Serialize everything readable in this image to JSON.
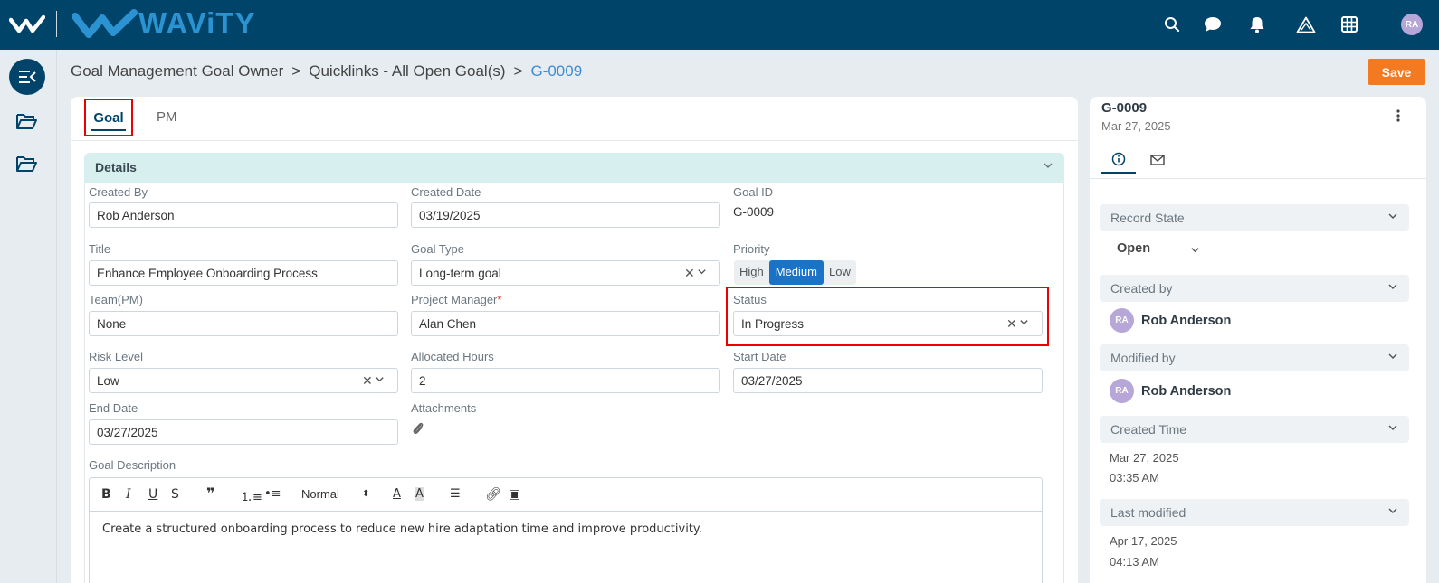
{
  "app": {
    "brand": "WAViTY",
    "avatar_initials": "RA",
    "colors": {
      "topbar": "#00446a",
      "accent": "#2b93d1",
      "save": "#f47a22",
      "highlight": "#e00000"
    }
  },
  "breadcrumb": {
    "items": [
      "Goal Management Goal Owner",
      "Quicklinks - All Open Goal(s)",
      "G-0009"
    ],
    "separator": ">"
  },
  "toolbar": {
    "save_label": "Save"
  },
  "tabs": [
    {
      "label": "Goal",
      "active": true
    },
    {
      "label": "PM",
      "active": false
    }
  ],
  "details": {
    "header": "Details",
    "created_by": {
      "label": "Created By",
      "value": "Rob Anderson"
    },
    "created_date": {
      "label": "Created Date",
      "value": "03/19/2025"
    },
    "goal_id": {
      "label": "Goal ID",
      "value": "G-0009"
    },
    "title": {
      "label": "Title",
      "value": "Enhance Employee Onboarding Process"
    },
    "goal_type": {
      "label": "Goal Type",
      "value": "Long-term goal"
    },
    "priority": {
      "label": "Priority",
      "options": [
        "High",
        "Medium",
        "Low"
      ],
      "selected": "Medium"
    },
    "team_pm": {
      "label": "Team(PM)",
      "value": "None"
    },
    "project_manager": {
      "label": "Project Manager",
      "required_mark": "*",
      "value": "Alan Chen"
    },
    "status": {
      "label": "Status",
      "value": "In Progress"
    },
    "risk_level": {
      "label": "Risk Level",
      "value": "Low"
    },
    "allocated_hours": {
      "label": "Allocated Hours",
      "value": "2"
    },
    "start_date": {
      "label": "Start Date",
      "value": "03/27/2025"
    },
    "end_date": {
      "label": "End Date",
      "value": "03/27/2025"
    },
    "attachments": {
      "label": "Attachments"
    },
    "goal_description": {
      "label": "Goal Description",
      "format": "Normal",
      "text": "Create a structured onboarding process to reduce new hire adaptation time and improve productivity."
    }
  },
  "side_panel": {
    "title": "G-0009",
    "date": "Mar 27, 2025",
    "record_state": {
      "label": "Record State",
      "value": "Open"
    },
    "created_by": {
      "label": "Created by",
      "initials": "RA",
      "name": "Rob Anderson"
    },
    "modified_by": {
      "label": "Modified by",
      "initials": "RA",
      "name": "Rob Anderson"
    },
    "created_time": {
      "label": "Created Time",
      "date": "Mar 27, 2025",
      "time": "03:35 AM"
    },
    "last_modified": {
      "label": "Last modified",
      "date": "Apr 17, 2025",
      "time": "04:13 AM"
    }
  }
}
